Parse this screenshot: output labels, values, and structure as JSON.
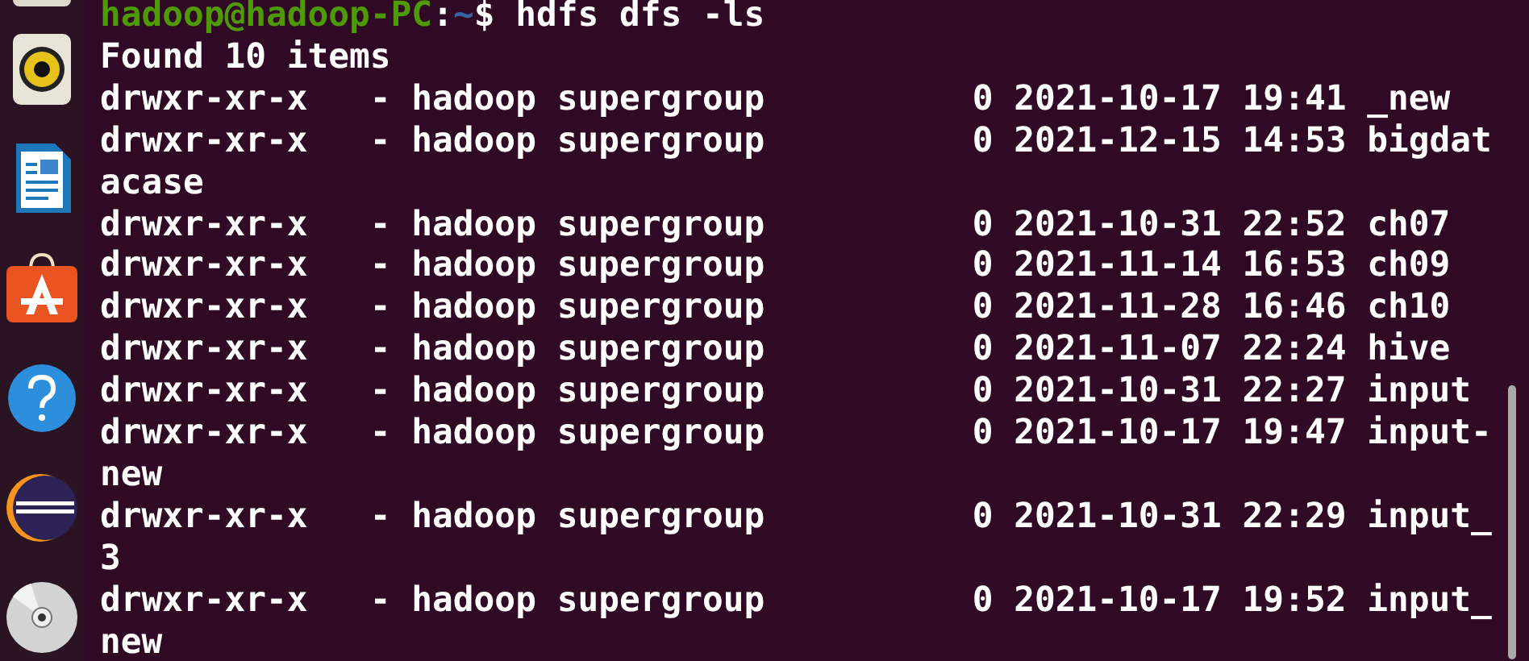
{
  "terminal": {
    "prompt": {
      "user_host": "hadoop@hadoop-PC",
      "separator": ":",
      "path": "~",
      "command": "$ hdfs dfs -ls"
    },
    "output_lines": [
      "Found 10 items",
      "drwxr-xr-x   - hadoop supergroup          0 2021-10-17 19:41 _new",
      "drwxr-xr-x   - hadoop supergroup          0 2021-12-15 14:53 bigdat",
      "acase",
      "drwxr-xr-x   - hadoop supergroup          0 2021-10-31 22:52 ch07",
      "drwxr-xr-x   - hadoop supergroup          0 2021-11-14 16:53 ch09",
      "drwxr-xr-x   - hadoop supergroup          0 2021-11-28 16:46 ch10",
      "drwxr-xr-x   - hadoop supergroup          0 2021-11-07 22:24 hive",
      "drwxr-xr-x   - hadoop supergroup          0 2021-10-31 22:27 input",
      "drwxr-xr-x   - hadoop supergroup          0 2021-10-17 19:47 input-",
      "new",
      "drwxr-xr-x   - hadoop supergroup          0 2021-10-31 22:29 input_",
      "3",
      "drwxr-xr-x   - hadoop supergroup          0 2021-10-17 19:52 input_",
      "new"
    ]
  }
}
